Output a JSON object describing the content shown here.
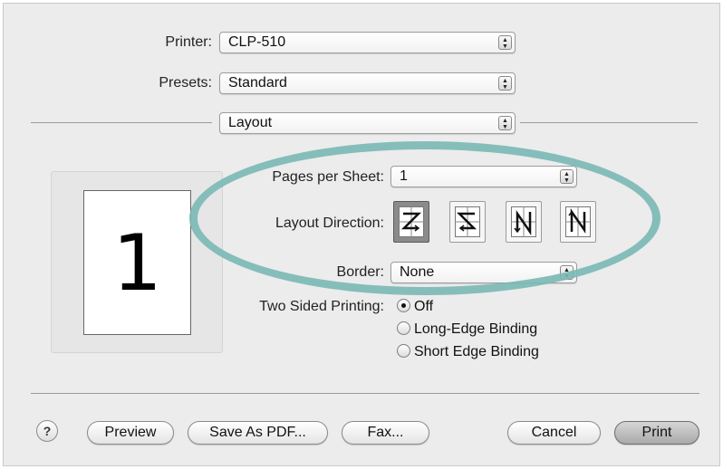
{
  "printer": {
    "label": "Printer:",
    "value": "CLP-510"
  },
  "presets": {
    "label": "Presets:",
    "value": "Standard"
  },
  "panel": {
    "value": "Layout"
  },
  "preview": {
    "page_number": "1"
  },
  "pages_per_sheet": {
    "label": "Pages per Sheet:",
    "value": "1"
  },
  "layout_direction": {
    "label": "Layout Direction:",
    "options": [
      {
        "icon": "z-direction-icon",
        "selected": true
      },
      {
        "icon": "reverse-z-direction-icon",
        "selected": false
      },
      {
        "icon": "n-reverse-direction-icon",
        "selected": false
      },
      {
        "icon": "n-direction-icon",
        "selected": false
      }
    ]
  },
  "border": {
    "label": "Border:",
    "value": "None"
  },
  "two_sided": {
    "label": "Two Sided Printing:",
    "options": [
      {
        "label": "Off",
        "checked": true
      },
      {
        "label": "Long-Edge Binding",
        "checked": false
      },
      {
        "label": "Short Edge Binding",
        "checked": false
      }
    ]
  },
  "buttons": {
    "help": "?",
    "preview": "Preview",
    "save_pdf": "Save As PDF...",
    "fax": "Fax...",
    "cancel": "Cancel",
    "print": "Print"
  },
  "colors": {
    "highlight_ellipse": "#7ab8b5",
    "dialog_bg": "#ececec"
  }
}
